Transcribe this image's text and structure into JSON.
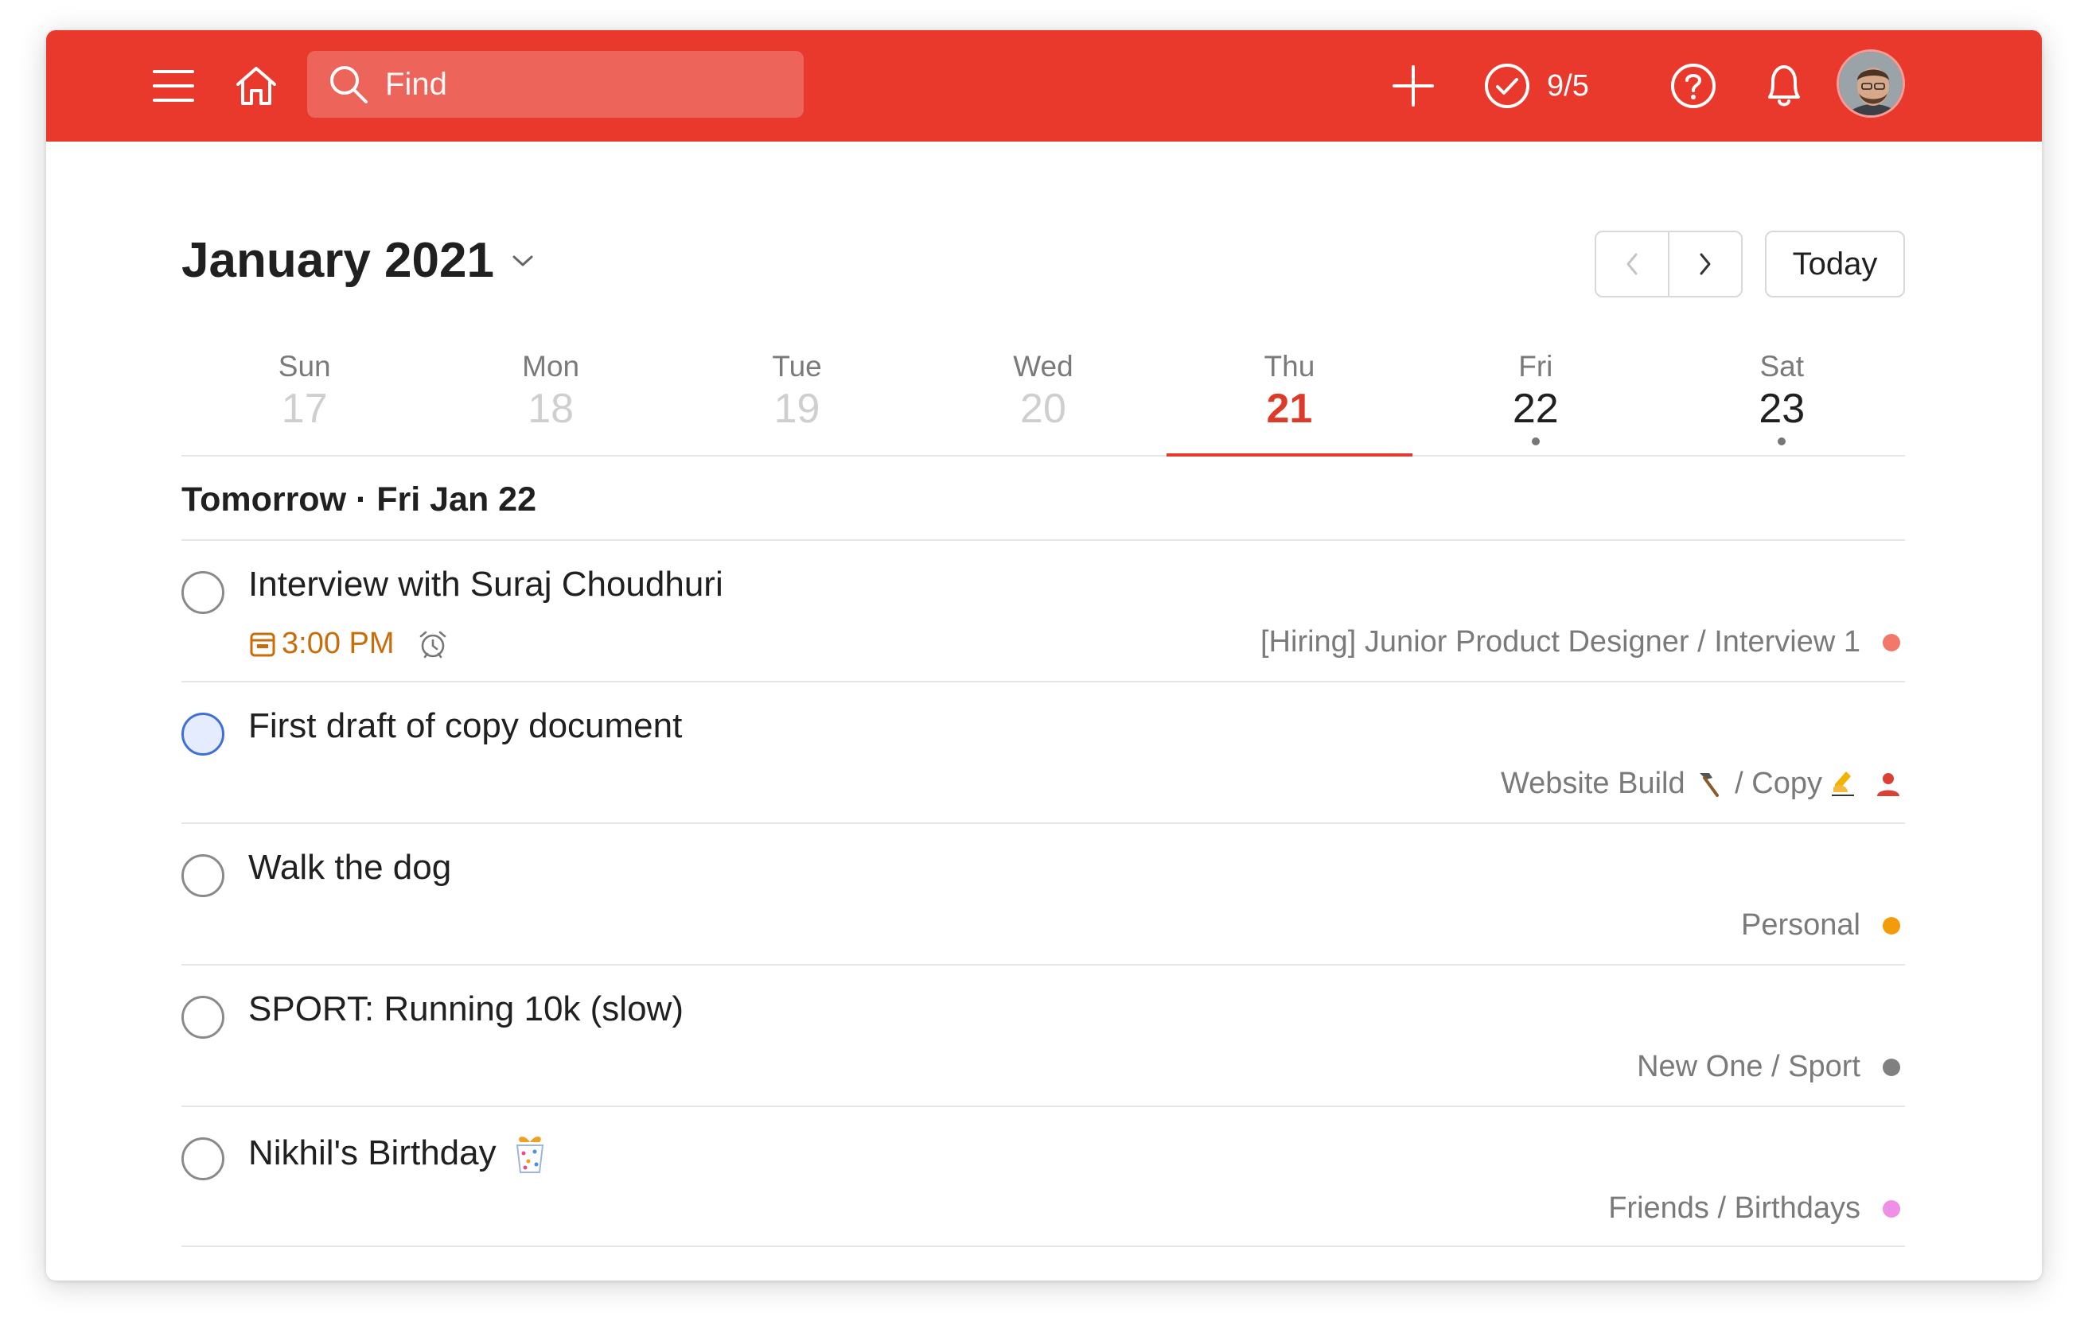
{
  "header": {
    "search_placeholder": "Find",
    "karma_text": "9/5",
    "colors": {
      "bar": "#e8392c"
    }
  },
  "calendar": {
    "month_title": "January 2021",
    "today_label": "Today",
    "days": [
      {
        "name": "Sun",
        "num": "17"
      },
      {
        "name": "Mon",
        "num": "18"
      },
      {
        "name": "Tue",
        "num": "19"
      },
      {
        "name": "Wed",
        "num": "20"
      },
      {
        "name": "Thu",
        "num": "21"
      },
      {
        "name": "Fri",
        "num": "22"
      },
      {
        "name": "Sat",
        "num": "23"
      }
    ]
  },
  "section": {
    "title": "Tomorrow · Fri Jan 22"
  },
  "tasks": [
    {
      "title": "Interview with Suraj Choudhuri",
      "due": "3:00 PM",
      "project": "[Hiring] Junior Product Designer / Interview 1",
      "project_color": "#f2786b"
    },
    {
      "title": "First draft of copy document",
      "project_a": "Website Build",
      "project_sep": " / ",
      "project_b": "Copy",
      "project_color": "#db4035"
    },
    {
      "title": "Walk the dog",
      "project": "Personal",
      "project_color": "#f39b0b"
    },
    {
      "title": "SPORT: Running 10k (slow)",
      "project": "New One / Sport",
      "project_color": "#808080"
    },
    {
      "title": "Nikhil's Birthday",
      "project": "Friends / Birthdays",
      "project_color": "#f08fe6"
    }
  ],
  "icons": [
    "menu-icon",
    "home-icon",
    "search-icon",
    "add-icon",
    "karma-check-icon",
    "help-icon",
    "bell-icon",
    "chevron-down-icon",
    "chevron-left-icon",
    "chevron-right-icon",
    "calendar-icon",
    "alarm-icon",
    "hammer-emoji-icon",
    "writing-hand-emoji-icon",
    "person-icon",
    "gift-emoji-icon"
  ]
}
